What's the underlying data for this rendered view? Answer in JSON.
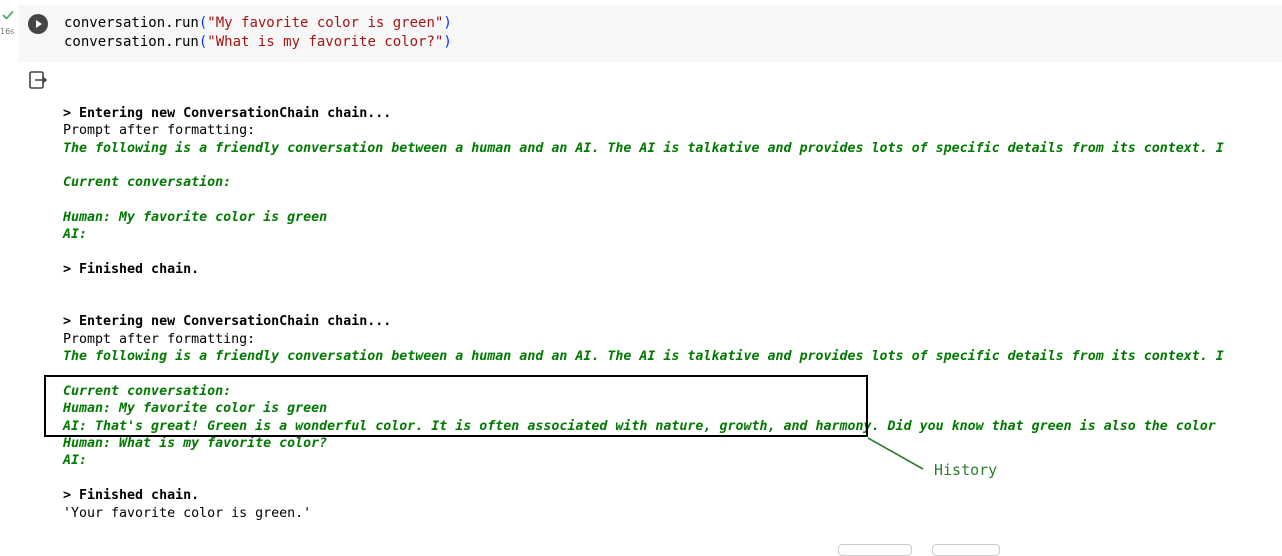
{
  "cell": {
    "exec_time": "16s",
    "code_lines": [
      {
        "fn": "conversation.run",
        "arg": "\"My favorite color is green\""
      },
      {
        "fn": "conversation.run",
        "arg": "\"What is my favorite color?\""
      }
    ]
  },
  "output": {
    "chain1_enter": "> Entering new ConversationChain chain...",
    "chain1_prompt_after": "Prompt after formatting:",
    "chain1_intro": "The following is a friendly conversation between a human and an AI. The AI is talkative and provides lots of specific details from its context. I",
    "chain1_current": "Current conversation:",
    "chain1_human": "Human: My favorite color is green",
    "chain1_ai": "AI:",
    "chain1_finished": "> Finished chain.",
    "chain2_enter": "> Entering new ConversationChain chain...",
    "chain2_prompt_after": "Prompt after formatting:",
    "chain2_intro": "The following is a friendly conversation between a human and an AI. The AI is talkative and provides lots of specific details from its context. I",
    "chain2_current": "Current conversation:",
    "chain2_human1": "Human: My favorite color is green",
    "chain2_ai1": "AI: That's great! Green is a wonderful color. It is often associated with nature, growth, and harmony. Did you know that green is also the color",
    "chain2_human2": "Human: What is my favorite color?",
    "chain2_ai2": "AI:",
    "chain2_finished": "> Finished chain.",
    "result": "'Your favorite color is green.'"
  },
  "annotation": {
    "label": "History",
    "color": "#2e7d32"
  },
  "colors": {
    "prompt_text": "#007a00",
    "string_literal": "#a31515",
    "cell_background": "#f7f7f7"
  }
}
